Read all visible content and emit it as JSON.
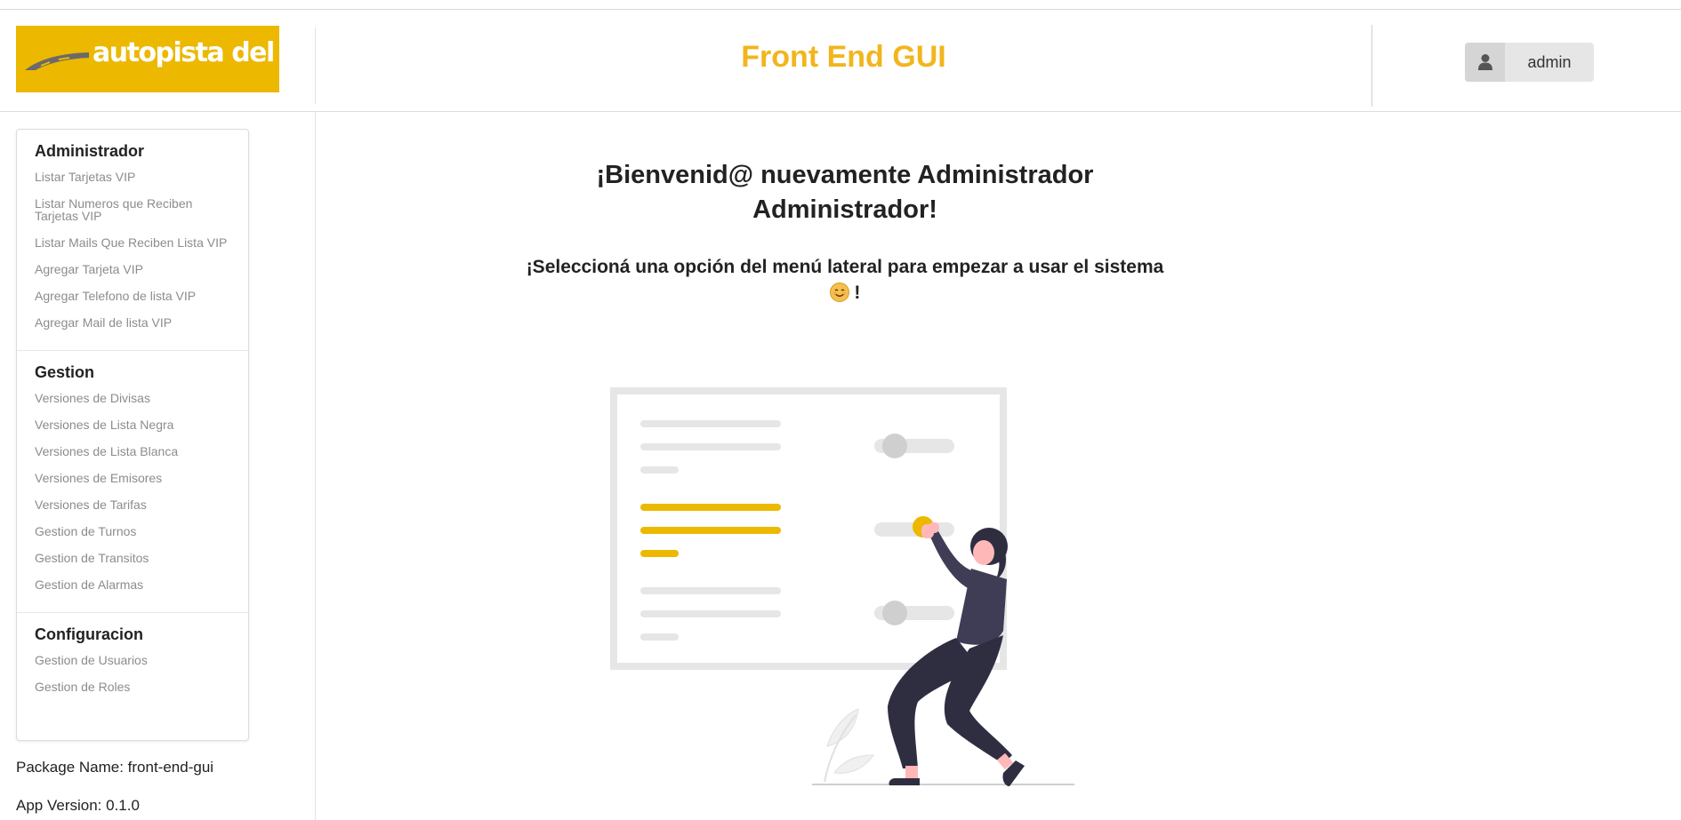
{
  "header": {
    "logo_text": "autopista del sol",
    "app_title": "Front End GUI",
    "user": {
      "icon": "user-icon",
      "name": "admin"
    }
  },
  "sidebar": {
    "sections": [
      {
        "title": "Administrador",
        "items": [
          "Listar Tarjetas VIP",
          "Listar Numeros que Reciben Tarjetas VIP",
          "Listar Mails Que Reciben Lista VIP",
          "Agregar Tarjeta VIP",
          "Agregar Telefono de lista VIP",
          "Agregar Mail de lista VIP"
        ]
      },
      {
        "title": "Gestion",
        "items": [
          "Versiones de Divisas",
          "Versiones de Lista Negra",
          "Versiones de Lista Blanca",
          "Versiones de Emisores",
          "Versiones de Tarifas",
          "Gestion de Turnos",
          "Gestion de Transitos",
          "Gestion de Alarmas"
        ]
      },
      {
        "title": "Configuracion",
        "items": [
          "Gestion de Usuarios",
          "Gestion de Roles"
        ]
      }
    ],
    "package_name": "Package Name: front-end-gui",
    "app_version": "App Version: 0.1.0"
  },
  "main": {
    "welcome_line1": "¡Bienvenid@ nuevamente Administrador",
    "welcome_line2": "Administrador!",
    "instruction_line1": "¡Seleccioná una opción del menú lateral para empezar a usar el sistema",
    "instruction_line2": "!",
    "instruction_emoji": "smiling-face-emoji",
    "illustration": "person-adjusting-settings-panel-illustration"
  },
  "colors": {
    "brand_yellow": "#ecb800",
    "title_yellow": "#f2b51c",
    "menu_item_gray": "#8c8c8c",
    "figure_dark": "#2f2e41"
  }
}
